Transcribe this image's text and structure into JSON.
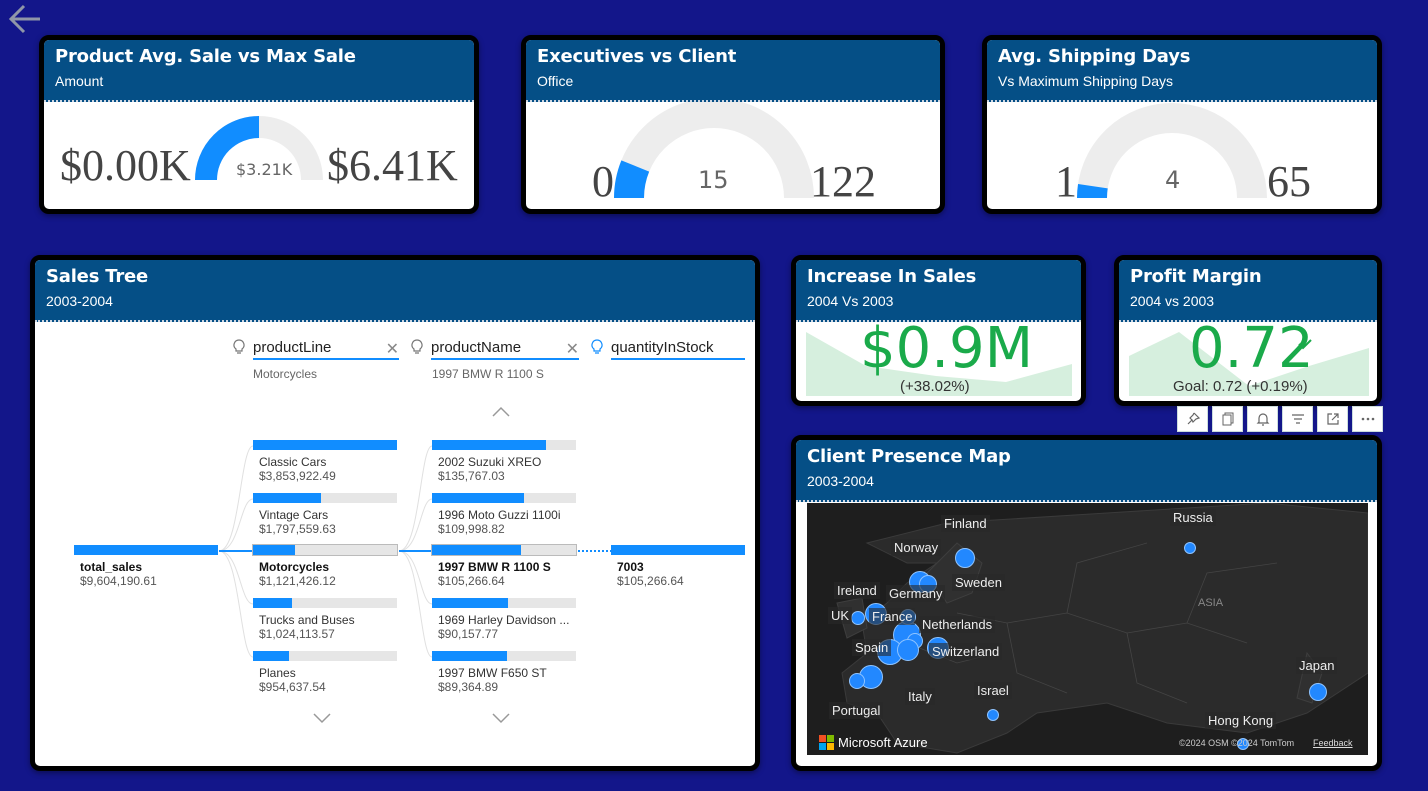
{
  "app": {
    "back_icon": "back-arrow-icon"
  },
  "gauge1": {
    "title": "Product Avg. Sale vs Max Sale",
    "subtitle": "Amount",
    "min": "$0.00K",
    "value": "$3.21K",
    "max": "$6.41K",
    "fraction": 0.5
  },
  "gauge2": {
    "title": "Executives vs Client",
    "subtitle": "Office",
    "min": "0",
    "value": "15",
    "max": "122",
    "fraction": 0.123
  },
  "gauge3": {
    "title": "Avg. Shipping Days",
    "subtitle": "Vs Maximum Shipping Days",
    "min": "1",
    "value": "4",
    "max": "65",
    "fraction": 0.047
  },
  "tree": {
    "title": "Sales Tree",
    "subtitle": "2003-2004",
    "levels": [
      {
        "name": "productLine",
        "selected": "Motorcycles"
      },
      {
        "name": "productName",
        "selected": "1997 BMW R 1100 S"
      },
      {
        "name": "quantityInStock"
      }
    ],
    "root": {
      "label": "total_sales",
      "value": "$9,604,190.61",
      "fill": 1.0
    },
    "productLines": [
      {
        "label": "Classic Cars",
        "value": "$3,853,922.49",
        "fill": 1.0
      },
      {
        "label": "Vintage Cars",
        "value": "$1,797,559.63",
        "fill": 0.47
      },
      {
        "label": "Motorcycles",
        "value": "$1,121,426.12",
        "fill": 0.29
      },
      {
        "label": "Trucks and Buses",
        "value": "$1,024,113.57",
        "fill": 0.27
      },
      {
        "label": "Planes",
        "value": "$954,637.54",
        "fill": 0.25
      }
    ],
    "productNames": [
      {
        "label": "2002 Suzuki XREO",
        "value": "$135,767.03",
        "fill": 0.79
      },
      {
        "label": "1996 Moto Guzzi 1100i",
        "value": "$109,998.82",
        "fill": 0.64
      },
      {
        "label": "1997 BMW R 1100 S",
        "value": "$105,266.64",
        "fill": 0.62
      },
      {
        "label": "1969 Harley Davidson ...",
        "value": "$90,157.77",
        "fill": 0.53
      },
      {
        "label": "1997 BMW F650 ST",
        "value": "$89,364.89",
        "fill": 0.52
      }
    ],
    "stock": {
      "label": "7003",
      "value": "$105,266.64",
      "fill": 1.0
    }
  },
  "kpi1": {
    "title": "Increase In Sales",
    "subtitle": "2004 Vs 2003",
    "value": "$0.9M",
    "detail": "(+38.02%)"
  },
  "kpi2": {
    "title": "Profit Margin",
    "subtitle": "2004 vs 2003",
    "value": "0.72",
    "detail": "Goal: 0.72 (+0.19%)",
    "check_icon": "checkmark-icon"
  },
  "toolbar": [
    "pin-icon",
    "copy-icon",
    "alert-bell-icon",
    "filter-icon",
    "focus-mode-icon",
    "more-options-icon"
  ],
  "map": {
    "title": "Client Presence Map",
    "subtitle": "2003-2004",
    "labels": [
      "Finland",
      "Russia",
      "Norway",
      "Sweden",
      "Ireland",
      "Germany",
      "UK",
      "France",
      "Netherlands",
      "Spain",
      "Switzerland",
      "ASIA",
      "Japan",
      "Israel",
      "Italy",
      "Portugal",
      "Hong Kong"
    ],
    "brand": "Microsoft Azure",
    "attribution": "©2024 OSM ©2024 TomTom",
    "feedback": "Feedback"
  },
  "colors": {
    "background": "#13168a",
    "header": "#054f86",
    "accent": "#118dff",
    "kpi_green": "#1aaa4a"
  }
}
